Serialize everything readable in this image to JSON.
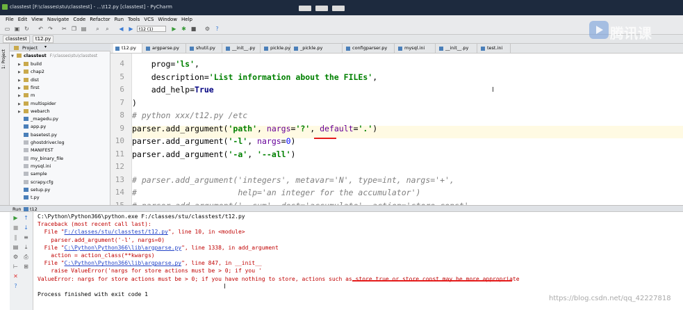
{
  "window": {
    "title": "classtest [F:\\classes\\stu\\classtest] - ...\\t12.py [classtest] - PyCharm"
  },
  "menu": [
    "File",
    "Edit",
    "View",
    "Navigate",
    "Code",
    "Refactor",
    "Run",
    "Tools",
    "VCS",
    "Window",
    "Help"
  ],
  "toolbar": {
    "run_config": "t12 (1)"
  },
  "breadcrumbs": [
    "classtest",
    "t12.py"
  ],
  "project": {
    "header": "Project",
    "root": "classtest",
    "root_path": "F:\\classes\\stu\\classtest",
    "items": [
      {
        "label": "build",
        "type": "folder"
      },
      {
        "label": "chap2",
        "type": "folder"
      },
      {
        "label": "dist",
        "type": "folder"
      },
      {
        "label": "first",
        "type": "folder"
      },
      {
        "label": "m",
        "type": "folder"
      },
      {
        "label": "multispider",
        "type": "folder"
      },
      {
        "label": "webarch",
        "type": "folder"
      },
      {
        "label": "_magedu.py",
        "type": "py"
      },
      {
        "label": "app.py",
        "type": "py"
      },
      {
        "label": "basetest.py",
        "type": "py"
      },
      {
        "label": "ghostdriver.log",
        "type": "txt"
      },
      {
        "label": "MANIFEST",
        "type": "txt"
      },
      {
        "label": "my_binary_file",
        "type": "txt"
      },
      {
        "label": "mysql.ini",
        "type": "txt"
      },
      {
        "label": "sample",
        "type": "txt"
      },
      {
        "label": "scrapy.cfg",
        "type": "txt"
      },
      {
        "label": "setup.py",
        "type": "py"
      },
      {
        "label": "t.py",
        "type": "py"
      }
    ]
  },
  "left_tool": "1: Project",
  "tabs": [
    {
      "label": "t12.py",
      "active": true
    },
    {
      "label": "argparse.py",
      "active": false
    },
    {
      "label": "shutil.py",
      "active": false
    },
    {
      "label": "__init__.py",
      "active": false
    },
    {
      "label": "pickle.py",
      "active": false
    },
    {
      "label": "_pickle.py",
      "active": false
    },
    {
      "label": "configparser.py",
      "active": false
    },
    {
      "label": "mysql.ini",
      "active": false
    },
    {
      "label": "__init__.py",
      "active": false
    },
    {
      "label": "test.ini",
      "active": false
    }
  ],
  "code_lines": [
    {
      "n": "4",
      "tokens": [
        [
          "",
          "    prog="
        ],
        [
          "st",
          "'ls'"
        ],
        [
          "",
          ","
        ]
      ]
    },
    {
      "n": "5",
      "tokens": [
        [
          "",
          "    description="
        ],
        [
          "st",
          "'List information about the FILEs'"
        ],
        [
          "",
          ","
        ]
      ]
    },
    {
      "n": "6",
      "tokens": [
        [
          "",
          "    add_help="
        ],
        [
          "bo",
          "True"
        ]
      ]
    },
    {
      "n": "7",
      "tokens": [
        [
          "",
          ")"
        ]
      ]
    },
    {
      "n": "8",
      "tokens": [
        [
          "cm",
          "# python xxx/t12.py /etc"
        ]
      ]
    },
    {
      "n": "9",
      "tokens": [
        [
          "",
          "parser.add_argument("
        ],
        [
          "st",
          "'path'"
        ],
        [
          "",
          ", "
        ],
        [
          "kw",
          "nargs"
        ],
        [
          "",
          "="
        ],
        [
          "st",
          "'?'"
        ],
        [
          "",
          ", "
        ],
        [
          "kw",
          "default"
        ],
        [
          "",
          "="
        ],
        [
          "st",
          "'.'"
        ],
        [
          "",
          ")"
        ]
      ]
    },
    {
      "n": "10",
      "tokens": [
        [
          "",
          "parser.add_argument("
        ],
        [
          "st",
          "'-l'"
        ],
        [
          "",
          ", "
        ],
        [
          "kw",
          "nargs"
        ],
        [
          "",
          "="
        ],
        [
          "num",
          "0"
        ],
        [
          "",
          ")"
        ]
      ]
    },
    {
      "n": "11",
      "tokens": [
        [
          "",
          "parser.add_argument("
        ],
        [
          "st",
          "'-a'"
        ],
        [
          "",
          ", "
        ],
        [
          "st",
          "'--all'"
        ],
        [
          "",
          ")"
        ]
      ]
    },
    {
      "n": "12",
      "tokens": [
        [
          "",
          ""
        ]
      ]
    },
    {
      "n": "13",
      "tokens": [
        [
          "cm",
          "# parser.add_argument('integers', metavar='N', type=int, nargs='+',"
        ]
      ]
    },
    {
      "n": "14",
      "tokens": [
        [
          "cm",
          "#                     help='an integer for the accumulator')"
        ]
      ]
    },
    {
      "n": "15",
      "tokens": [
        [
          "cm",
          "# parser.add_argument('--sum', dest='accumulate', action='store_const',"
        ]
      ]
    },
    {
      "n": "16",
      "tokens": [
        [
          "cm",
          "#                     const=sum, default=max,"
        ]
      ]
    },
    {
      "n": "17",
      "tokens": [
        [
          "cm",
          "#"
        ]
      ]
    }
  ],
  "run": {
    "label": "Run",
    "tab": "t12"
  },
  "console_lines": [
    {
      "cls": "",
      "parts": [
        [
          "",
          "C:\\Python\\Python366\\python.exe F:/classes/stu/classtest/t12.py"
        ]
      ]
    },
    {
      "cls": "err",
      "parts": [
        [
          "",
          "Traceback (most recent call last):"
        ]
      ]
    },
    {
      "cls": "err",
      "parts": [
        [
          "",
          "  File \""
        ],
        [
          "lnk",
          "F:/classes/stu/classtest/t12.py"
        ],
        [
          "",
          "\", line 10, in <module>"
        ]
      ]
    },
    {
      "cls": "err",
      "parts": [
        [
          "",
          "    parser.add_argument('-l', nargs=0)"
        ]
      ]
    },
    {
      "cls": "err",
      "parts": [
        [
          "",
          "  File \""
        ],
        [
          "lnk",
          "C:\\Python\\Python366\\lib\\argparse.py"
        ],
        [
          "",
          "\", line 1338, in add_argument"
        ]
      ]
    },
    {
      "cls": "err",
      "parts": [
        [
          "",
          "    action = action_class(**kwargs)"
        ]
      ]
    },
    {
      "cls": "err",
      "parts": [
        [
          "",
          "  File \""
        ],
        [
          "lnk",
          "C:\\Python\\Python366\\lib\\argparse.py"
        ],
        [
          "",
          "\", line 847, in __init__"
        ]
      ]
    },
    {
      "cls": "err",
      "parts": [
        [
          "",
          "    raise ValueError('nargs for store actions must be > 0; if you '"
        ]
      ]
    },
    {
      "cls": "err",
      "parts": [
        [
          "",
          "ValueError: nargs for store actions must be > 0; if you have nothing to store, actions such as store true or store const may be more appropriate"
        ]
      ]
    },
    {
      "cls": "",
      "parts": [
        [
          "",
          ""
        ]
      ]
    },
    {
      "cls": "",
      "parts": [
        [
          "",
          "Process finished with exit code 1"
        ]
      ]
    }
  ],
  "watermark": {
    "text": "腾讯课"
  },
  "csdn": "https://blog.csdn.net/qq_42227818"
}
